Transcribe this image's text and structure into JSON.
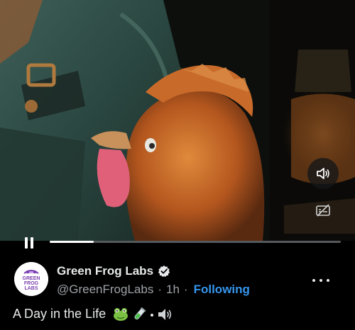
{
  "player": {
    "progress": 0.15,
    "muted": false
  },
  "account": {
    "avatar_text_line1": "GREEN",
    "avatar_text_line2": "FROG",
    "avatar_text_line3": "LABS",
    "display_name": "Green Frog Labs",
    "handle": "@GreenFrogLabs",
    "separator": "·",
    "time_ago": "1h",
    "follow_state": "Following"
  },
  "post": {
    "text": "A Day in the Life",
    "emojis": [
      "frog-emoji",
      "test-tube-emoji",
      "dot-emoji",
      "speaker-emoji"
    ]
  },
  "icons": {
    "volume": "speaker-volume-icon",
    "captions": "captions-off-icon",
    "pause": "pause-icon",
    "verified": "verified-badge-icon",
    "more": "more-dots-icon"
  },
  "colors": {
    "accent": "#3795ee",
    "background": "#000000",
    "muted_text": "#9da2a6"
  }
}
